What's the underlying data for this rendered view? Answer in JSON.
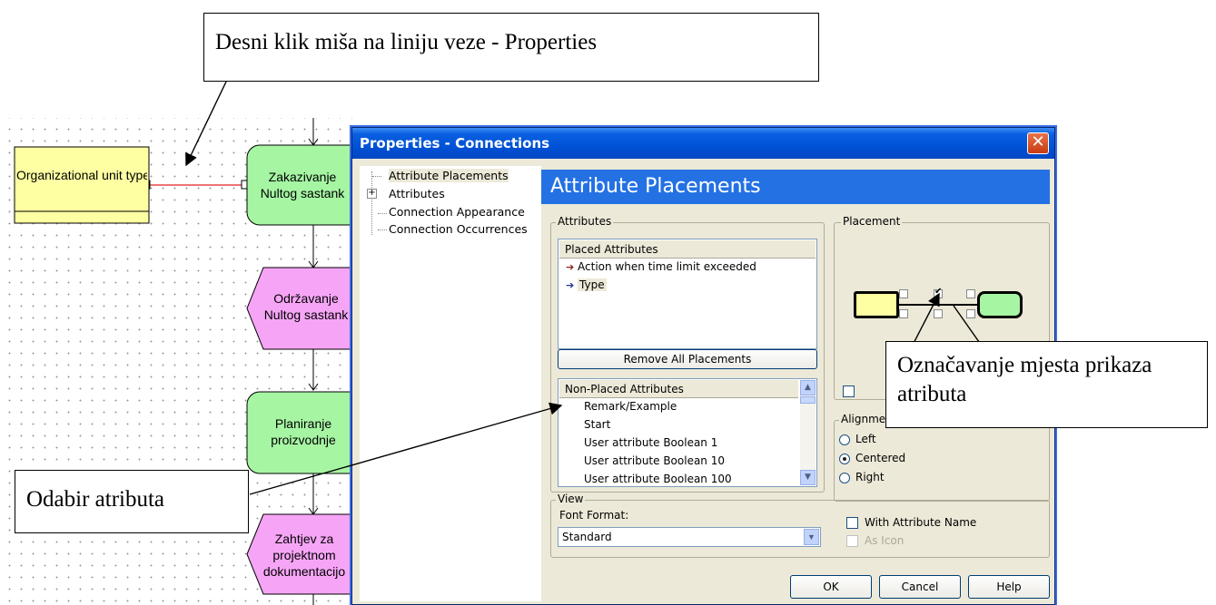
{
  "callouts": {
    "top": "Desni klik miša na liniju veze - Properties",
    "bottom_left": "Odabir atributa",
    "right": "Označavanje mjesta prikaza atributa"
  },
  "diagram": {
    "org_unit": "Organizational unit type",
    "shapes": [
      {
        "label": "Zakazivanje Nultog sastank",
        "kind": "function",
        "color": "#a6f5a3"
      },
      {
        "label": "Održavanje Nultog sastank",
        "kind": "event",
        "color": "#f6a5f6"
      },
      {
        "label": "Planiranje proizvodnje",
        "kind": "function",
        "color": "#a6f5a3"
      },
      {
        "label": "Zahtjev za projektnom dokumentacijo",
        "kind": "event",
        "color": "#f6a5f6"
      }
    ]
  },
  "dialog": {
    "title": "Properties - Connections",
    "close_icon": "close-icon",
    "tree": [
      "Attribute Placements",
      "Attributes",
      "Connection Appearance",
      "Connection Occurrences"
    ],
    "banner": "Attribute Placements",
    "attributes_group": "Attributes",
    "placed_header": "Placed Attributes",
    "placed": [
      "Action when time limit exceeded",
      "Type"
    ],
    "remove_button": "Remove All Placements",
    "non_placed_header": "Non-Placed Attributes",
    "non_placed": [
      "Remark/Example",
      "Start",
      "User attribute Boolean 1",
      "User attribute Boolean 10",
      "User attribute Boolean 100"
    ],
    "placement_group": "Placement",
    "alignment_group": "Alignme",
    "alignment": {
      "left": "Left",
      "centered": "Centered",
      "right": "Right",
      "selected": "Centered"
    },
    "view_group": "View",
    "font_format_label": "Font Format:",
    "font_format_value": "Standard",
    "with_attribute_name": "With Attribute Name",
    "as_icon": "As Icon",
    "ok": "OK",
    "cancel": "Cancel",
    "help": "Help"
  }
}
